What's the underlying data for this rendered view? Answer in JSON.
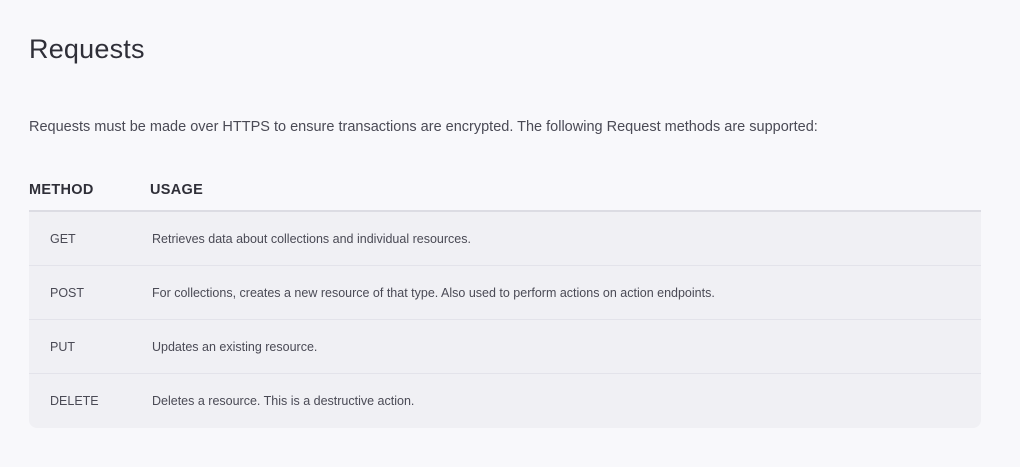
{
  "title": "Requests",
  "intro": "Requests must be made over HTTPS to ensure transactions are encrypted. The following Request methods are supported:",
  "table": {
    "headers": {
      "method": "METHOD",
      "usage": "USAGE"
    },
    "rows": [
      {
        "method": "GET",
        "usage": "Retrieves data about collections and individual resources."
      },
      {
        "method": "POST",
        "usage": "For collections, creates a new resource of that type. Also used to perform actions on action endpoints."
      },
      {
        "method": "PUT",
        "usage": "Updates an existing resource."
      },
      {
        "method": "DELETE",
        "usage": "Deletes a resource. This is a destructive action."
      }
    ]
  }
}
